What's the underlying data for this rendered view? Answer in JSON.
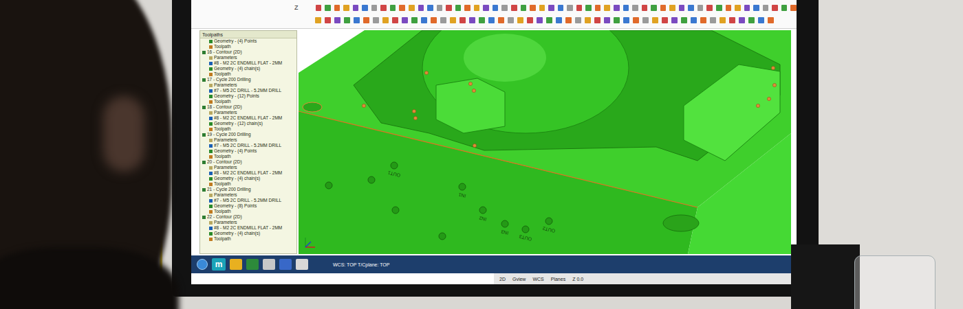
{
  "toolbar": {
    "labels": [
      "Z"
    ]
  },
  "tree": {
    "title": "Toolpaths",
    "items": [
      {
        "label": "Geometry - (4) Points",
        "kind": "geometry"
      },
      {
        "label": "Toolpath",
        "kind": "toolpath"
      },
      {
        "label": "16 - Contour (2D)",
        "kind": "operation"
      },
      {
        "label": "Parameters",
        "kind": "parameters"
      },
      {
        "label": "#8 - M2 2C ENDMILL FLAT - 2MM",
        "kind": "tool"
      },
      {
        "label": "Geometry - (4) chain(s)",
        "kind": "geometry"
      },
      {
        "label": "Toolpath",
        "kind": "toolpath"
      },
      {
        "label": "17 - Cycle 200 Drilling",
        "kind": "operation"
      },
      {
        "label": "Parameters",
        "kind": "parameters"
      },
      {
        "label": "#7 - M5 2C DRILL - 5.2MM DRILL",
        "kind": "tool"
      },
      {
        "label": "Geometry - (12) Points",
        "kind": "geometry"
      },
      {
        "label": "Toolpath",
        "kind": "toolpath"
      },
      {
        "label": "18 - Contour (2D)",
        "kind": "operation"
      },
      {
        "label": "Parameters",
        "kind": "parameters"
      },
      {
        "label": "#8 - M2 2C ENDMILL FLAT - 2MM",
        "kind": "tool"
      },
      {
        "label": "Geometry - (12) chain(s)",
        "kind": "geometry"
      },
      {
        "label": "Toolpath",
        "kind": "toolpath"
      },
      {
        "label": "19 - Cycle 200 Drilling",
        "kind": "operation"
      },
      {
        "label": "Parameters",
        "kind": "parameters"
      },
      {
        "label": "#7 - M5 2C DRILL - 5.2MM DRILL",
        "kind": "tool"
      },
      {
        "label": "Geometry - (4) Points",
        "kind": "geometry"
      },
      {
        "label": "Toolpath",
        "kind": "toolpath"
      },
      {
        "label": "20 - Contour (2D)",
        "kind": "operation"
      },
      {
        "label": "Parameters",
        "kind": "parameters"
      },
      {
        "label": "#8 - M2 2C ENDMILL FLAT - 2MM",
        "kind": "tool"
      },
      {
        "label": "Geometry - (4) chain(s)",
        "kind": "geometry"
      },
      {
        "label": "Toolpath",
        "kind": "toolpath"
      },
      {
        "label": "21 - Cycle 200 Drilling",
        "kind": "operation"
      },
      {
        "label": "Parameters",
        "kind": "parameters"
      },
      {
        "label": "#7 - M5 2C DRILL - 5.2MM DRILL",
        "kind": "tool"
      },
      {
        "label": "Geometry - (8) Points",
        "kind": "geometry"
      },
      {
        "label": "Toolpath",
        "kind": "toolpath"
      },
      {
        "label": "22 - Contour (2D)",
        "kind": "operation"
      },
      {
        "label": "Parameters",
        "kind": "parameters"
      },
      {
        "label": "#8 - M2 2C ENDMILL FLAT - 2MM",
        "kind": "tool"
      },
      {
        "label": "Geometry - (4) chain(s)",
        "kind": "geometry"
      },
      {
        "label": "Toolpath",
        "kind": "toolpath"
      }
    ]
  },
  "viewport": {
    "port_labels": [
      "OUT1",
      "IN1",
      "IN2",
      "IN3",
      "OUT3",
      "OUT2"
    ],
    "plane_info": "WCS: TOP  T/Cplane: TOP"
  },
  "taskbar": {
    "app_letter": "m"
  },
  "status_bar": {
    "items": [
      "2D",
      "Gview",
      "WCS",
      "Planes",
      "Z 0.0"
    ]
  }
}
